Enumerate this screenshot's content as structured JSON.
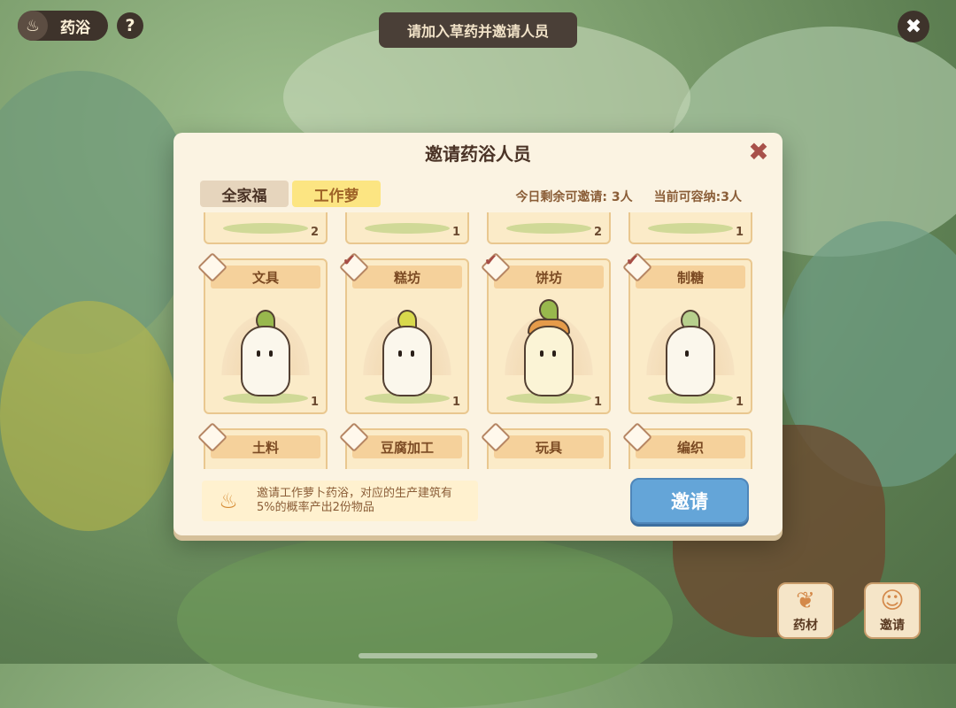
{
  "header": {
    "title": "药浴",
    "help_label": "?",
    "banner_text": "请加入草药并邀请人员",
    "close_label": "✖"
  },
  "panel": {
    "title": "邀请药浴人员",
    "close_label": "✖",
    "tabs": [
      {
        "label": "全家福",
        "active": false
      },
      {
        "label": "工作萝",
        "active": true
      }
    ],
    "remaining_invites": "今日剩余可邀请: 3人",
    "capacity": "当前可容纳:3人",
    "top_row_counts": [
      "2",
      "1",
      "2",
      "1"
    ],
    "cards": [
      {
        "label": "文具",
        "count": "1",
        "checked": false
      },
      {
        "label": "糕坊",
        "count": "1",
        "checked": true
      },
      {
        "label": "饼坊",
        "count": "1",
        "checked": true
      },
      {
        "label": "制糖",
        "count": "1",
        "checked": true
      }
    ],
    "bottom_row": [
      {
        "label": "土料",
        "checked": false
      },
      {
        "label": "豆腐加工",
        "checked": false
      },
      {
        "label": "玩具",
        "checked": false
      },
      {
        "label": "编织",
        "checked": false
      }
    ],
    "note": "邀请工作萝卜药浴，对应的生产建筑有5%的概率产出2份物品",
    "invite_button": "邀请"
  },
  "side_buttons": {
    "herbs": "药材",
    "invite": "邀请"
  },
  "colors": {
    "panel_bg": "#fbf3e2",
    "invite_btn": "#64a5d8",
    "tab_active": "#fce582"
  }
}
